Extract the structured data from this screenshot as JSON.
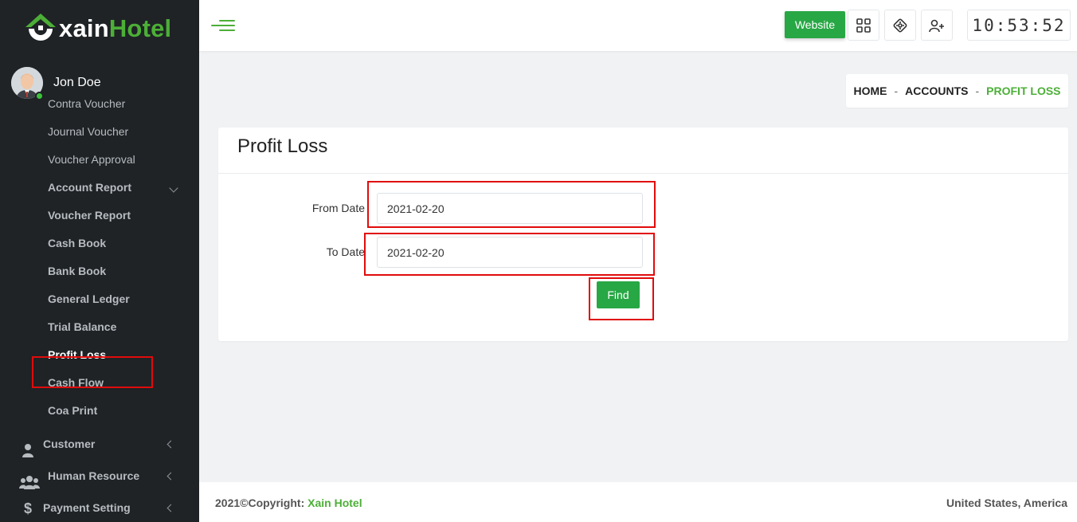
{
  "brand": {
    "part1": "xain",
    "part2": "Hotel",
    "accent": "#4caf37"
  },
  "user": {
    "name": "Jon Doe",
    "status": "online"
  },
  "sidebar": {
    "sub_items": [
      {
        "label": "Contra Voucher"
      },
      {
        "label": "Journal Voucher"
      },
      {
        "label": "Voucher Approval"
      },
      {
        "label": "Account Report"
      },
      {
        "label": "Voucher Report"
      },
      {
        "label": "Cash Book"
      },
      {
        "label": "Bank Book"
      },
      {
        "label": "General Ledger"
      },
      {
        "label": "Trial Balance"
      },
      {
        "label": "Profit Loss"
      },
      {
        "label": "Cash Flow"
      },
      {
        "label": "Coa Print"
      }
    ],
    "main_items": [
      {
        "label": "Customer",
        "icon": "user-icon"
      },
      {
        "label": "Human Resource",
        "icon": "users-icon"
      },
      {
        "label": "Payment Setting",
        "icon": "dollar-icon"
      }
    ]
  },
  "topbar": {
    "website_label": "Website",
    "icons": [
      "grid-icon",
      "compass-icon",
      "add-user-icon"
    ],
    "clock": "10:53:52"
  },
  "breadcrumb": {
    "home": "HOME",
    "sep": "-",
    "section": "ACCOUNTS",
    "current": "PROFIT LOSS"
  },
  "card": {
    "title": "Profit Loss",
    "from_label": "From Date",
    "from_value": "2021-02-20",
    "to_label": "To Date",
    "to_value": "2021-02-20",
    "find_label": "Find"
  },
  "footer": {
    "copyright": "2021©Copyright: ",
    "brand": "Xain Hotel",
    "location": "United States, America"
  },
  "colors": {
    "sidebar_bg": "#1f2326",
    "primary_green": "#28a745",
    "highlight_red": "#e10b0b"
  }
}
